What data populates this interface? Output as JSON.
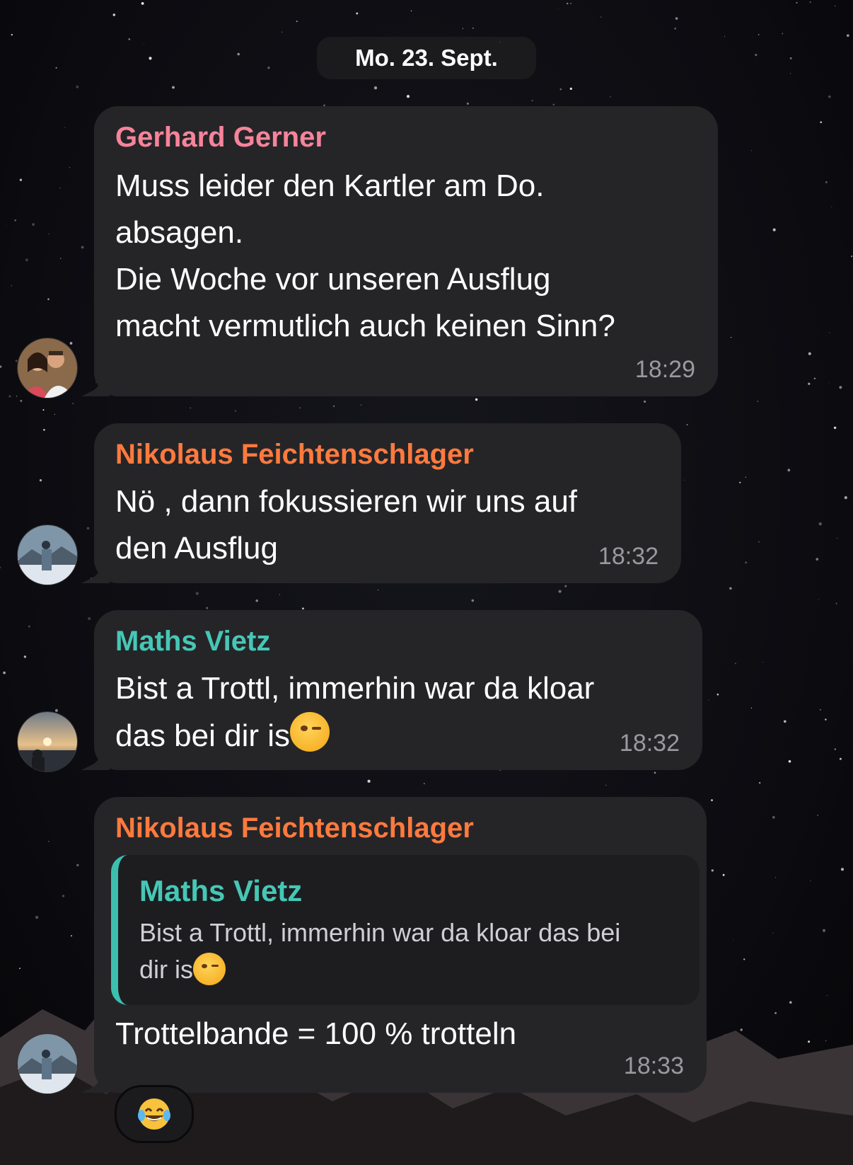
{
  "date": "Mo. 23. Sept.",
  "colors": {
    "gerhard": "#f6849a",
    "nikolaus": "#ff7a3e",
    "maths": "#46c7b6"
  },
  "messages": [
    {
      "sender": "Gerhard Gerner",
      "lines": [
        "Muss leider den Kartler am Do.",
        "absagen.",
        "Die Woche vor unseren Ausflug",
        "macht vermutlich auch keinen Sinn?"
      ],
      "time": "18:29"
    },
    {
      "sender": "Nikolaus Feichtenschlager",
      "lines": [
        "Nö , dann fokussieren wir uns auf",
        "den Ausflug"
      ],
      "time": "18:32"
    },
    {
      "sender": "Maths Vietz",
      "lines": [
        "Bist a Trottl, immerhin war da kloar",
        "das bei dir is"
      ],
      "emoji": "winking-face",
      "time": "18:32"
    },
    {
      "sender": "Nikolaus Feichtenschlager",
      "reply_to": {
        "sender": "Maths Vietz",
        "lines": [
          "Bist a Trottl, immerhin war da kloar das bei",
          "dir is"
        ],
        "emoji": "winking-face"
      },
      "text": "Trottelbande = 100 % trotteln",
      "time": "18:33",
      "reaction": "laughing-tears"
    }
  ]
}
